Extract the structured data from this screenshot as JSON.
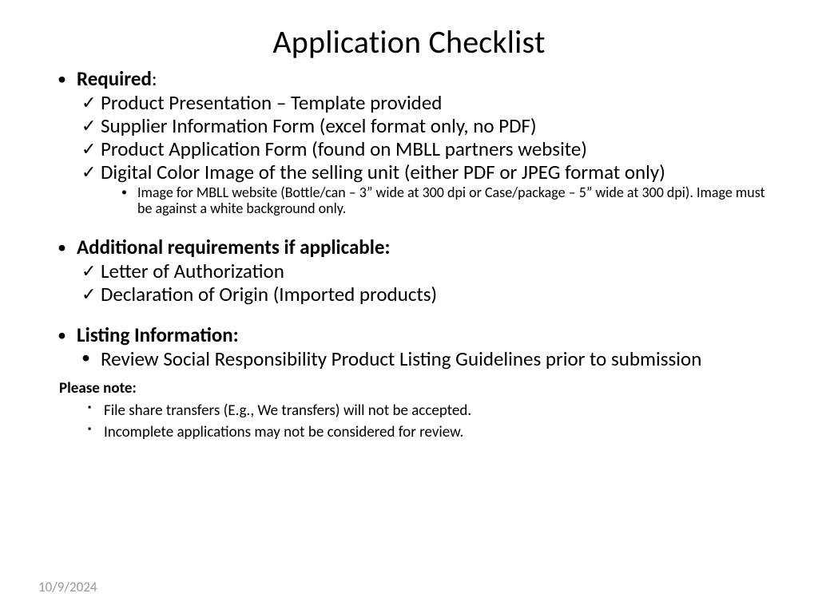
{
  "title": "Application Checklist",
  "sections": [
    {
      "heading_strong": "Required",
      "heading_tail": ":",
      "check_items": [
        "Product Presentation – Template provided",
        "Supplier Information Form (excel format only, no PDF)",
        "Product Application Form (found on MBLL partners website)",
        "Digital Color Image of the selling unit (either PDF or JPEG format only)"
      ],
      "sub_note": "Image for MBLL website (Bottle/can – 3” wide at 300 dpi or Case/package – 5” wide at 300 dpi). Image must be against a white background only."
    },
    {
      "heading_strong": "Additional requirements if applicable:",
      "heading_tail": "",
      "check_items": [
        "Letter of Authorization",
        "Declaration of Origin (Imported products)"
      ]
    },
    {
      "heading_strong": "Listing Information:",
      "heading_tail": "",
      "dot_items": [
        "Review Social Responsibility Product Listing Guidelines prior to submission"
      ]
    }
  ],
  "note": {
    "heading": "Please note:",
    "items": [
      "File share transfers (E.g., We transfers) will not be accepted.",
      "Incomplete applications may not be considered for review."
    ]
  },
  "date": "10/9/2024"
}
